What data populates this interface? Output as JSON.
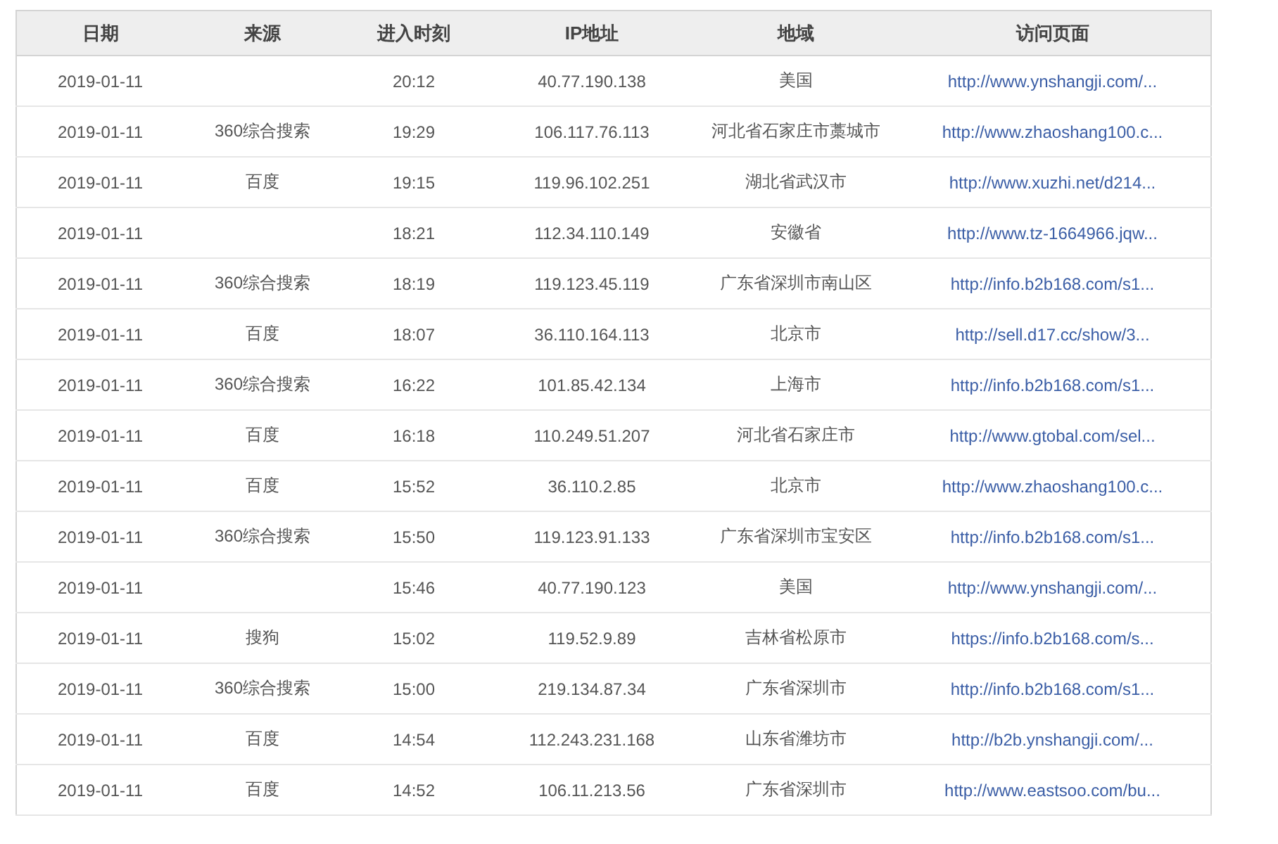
{
  "table": {
    "columns": [
      "日期",
      "来源",
      "进入时刻",
      "IP地址",
      "地域",
      "访问页面"
    ],
    "rows": [
      {
        "date": "2019-01-11",
        "time": "20:12",
        "ip": "40.77.190.138",
        "region": "美国",
        "page": "http://www.ynshangji.com/..."
      },
      {
        "date": "2019-01-11",
        "source": "360综合搜索",
        "time": "19:29",
        "ip": "106.117.76.113",
        "region": "河北省石家庄市藁城市",
        "page": "http://www.zhaoshang100.c..."
      },
      {
        "date": "2019-01-11",
        "source": "百度",
        "time": "19:15",
        "ip": "119.96.102.251",
        "region": "湖北省武汉市",
        "page": "http://www.xuzhi.net/d214..."
      },
      {
        "date": "2019-01-11",
        "time": "18:21",
        "ip": "112.34.110.149",
        "region": "安徽省",
        "page": "http://www.tz-1664966.jqw..."
      },
      {
        "date": "2019-01-11",
        "source": "360综合搜索",
        "time": "18:19",
        "ip": "119.123.45.119",
        "region": "广东省深圳市南山区",
        "page": "http://info.b2b168.com/s1..."
      },
      {
        "date": "2019-01-11",
        "source": "百度",
        "time": "18:07",
        "ip": "36.110.164.113",
        "region": "北京市",
        "page": "http://sell.d17.cc/show/3..."
      },
      {
        "date": "2019-01-11",
        "source": "360综合搜索",
        "time": "16:22",
        "ip": "101.85.42.134",
        "region": "上海市",
        "page": "http://info.b2b168.com/s1..."
      },
      {
        "date": "2019-01-11",
        "source": "百度",
        "time": "16:18",
        "ip": "110.249.51.207",
        "region": "河北省石家庄市",
        "page": "http://www.gtobal.com/sel..."
      },
      {
        "date": "2019-01-11",
        "source": "百度",
        "time": "15:52",
        "ip": "36.110.2.85",
        "region": "北京市",
        "page": "http://www.zhaoshang100.c..."
      },
      {
        "date": "2019-01-11",
        "source": "360综合搜索",
        "time": "15:50",
        "ip": "119.123.91.133",
        "region": "广东省深圳市宝安区",
        "page": "http://info.b2b168.com/s1..."
      },
      {
        "date": "2019-01-11",
        "time": "15:46",
        "ip": "40.77.190.123",
        "region": "美国",
        "page": "http://www.ynshangji.com/..."
      },
      {
        "date": "2019-01-11",
        "source": "搜狗",
        "time": "15:02",
        "ip": "119.52.9.89",
        "region": "吉林省松原市",
        "page": "https://info.b2b168.com/s..."
      },
      {
        "date": "2019-01-11",
        "source": "360综合搜索",
        "time": "15:00",
        "ip": "219.134.87.34",
        "region": "广东省深圳市",
        "page": "http://info.b2b168.com/s1..."
      },
      {
        "date": "2019-01-11",
        "source": "百度",
        "time": "14:54",
        "ip": "112.243.231.168",
        "region": "山东省潍坊市",
        "page": "http://b2b.ynshangji.com/..."
      },
      {
        "date": "2019-01-11",
        "source": "百度",
        "time": "14:52",
        "ip": "106.11.213.56",
        "region": "广东省深圳市",
        "page": "http://www.eastsoo.com/bu..."
      }
    ]
  }
}
